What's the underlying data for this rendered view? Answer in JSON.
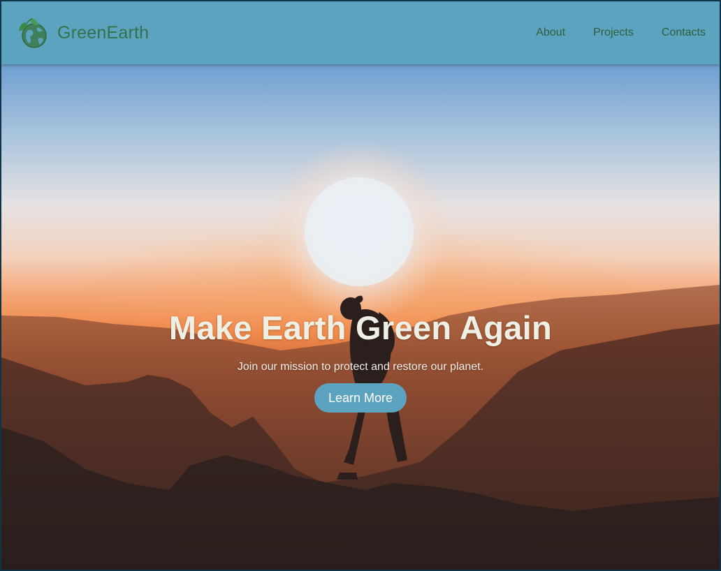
{
  "header": {
    "brand_name": "GreenEarth",
    "logo_icon": "earth-leaf-icon",
    "nav": [
      {
        "label": "About"
      },
      {
        "label": "Projects"
      },
      {
        "label": "Contacts"
      }
    ]
  },
  "hero": {
    "title": "Make Earth Green Again",
    "subtitle": "Join our mission to protect and restore our planet.",
    "cta_label": "Learn More",
    "background_image": "sunset-mountains-hiker-photo"
  },
  "colors": {
    "header_bg": "#5ca3bf",
    "brand_text": "#36704d",
    "nav_text": "#2f5e3c",
    "button_bg": "#5ca3bf",
    "title_text": "#eef0e6"
  }
}
